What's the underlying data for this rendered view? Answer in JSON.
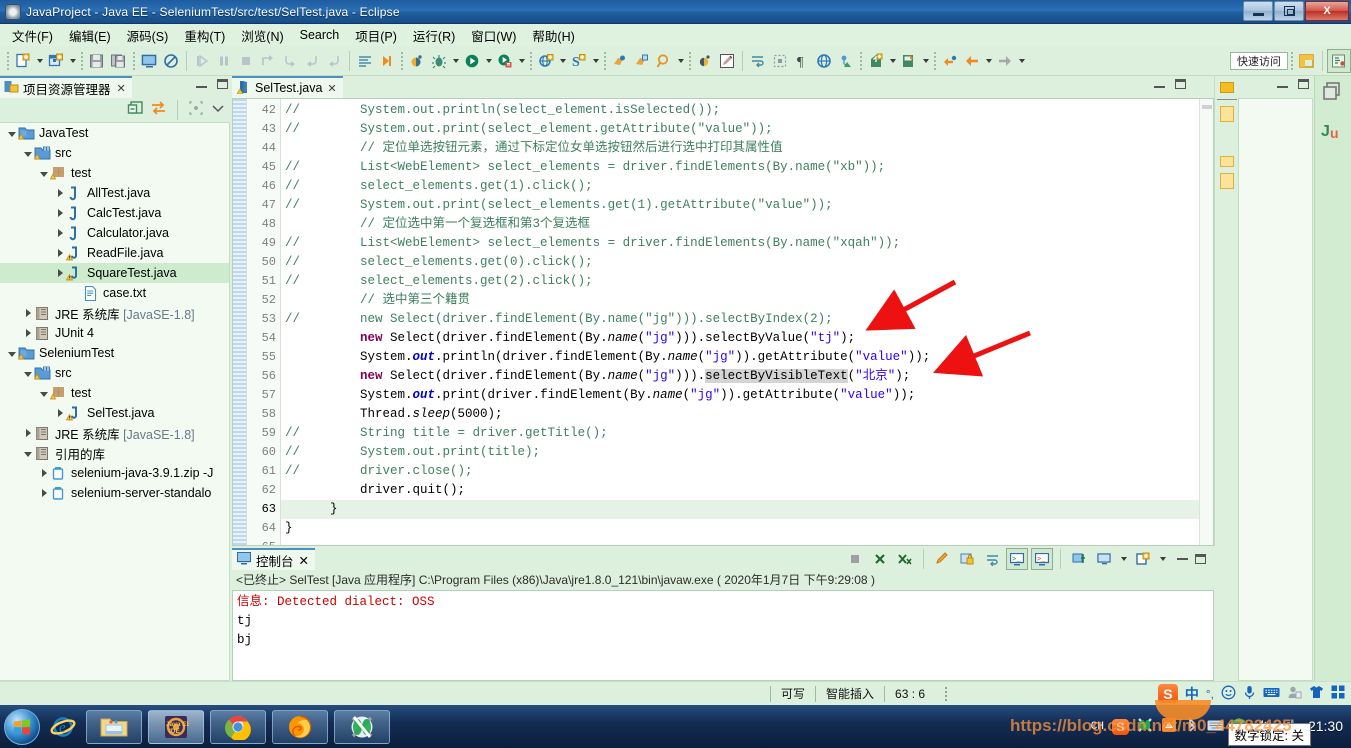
{
  "window": {
    "title": "JavaProject  -  Java EE  -  SeleniumTest/src/test/SelTest.java  -  Eclipse",
    "minimize_label": "最小化",
    "restore_label": "还原",
    "close_label": "X"
  },
  "menu": {
    "items": [
      {
        "label": "文件(F)"
      },
      {
        "label": "编辑(E)"
      },
      {
        "label": "源码(S)"
      },
      {
        "label": "重构(T)"
      },
      {
        "label": "浏览(N)"
      },
      {
        "label": "Search"
      },
      {
        "label": "项目(P)"
      },
      {
        "label": "运行(R)"
      },
      {
        "label": "窗口(W)"
      },
      {
        "label": "帮助(H)"
      }
    ]
  },
  "toolbar": {
    "quick_access": "快速访问",
    "icons": [
      "new-wizard-icon",
      "new-dropdown-icon",
      "new-java-project-icon",
      "new-java-dropdown-icon",
      "save-icon",
      "save-all-icon",
      "print-screen-icon",
      "no-entry-icon",
      "resume-icon",
      "suspend-icon",
      "terminate-icon",
      "step-over-icon",
      "step-into-icon",
      "step-return-icon",
      "step-out-icon",
      "format-icon",
      "run-last-tool-icon",
      "coverage-icon",
      "debug-icon",
      "debug-dropdown-icon",
      "run-icon",
      "run-dropdown-icon",
      "external-tools-icon",
      "external-tools-dropdown-icon",
      "web-browser-icon",
      "web-dropdown-icon",
      "search-string-icon",
      "search-dropdown-icon",
      "open-type-icon",
      "open-task-icon",
      "search-icon",
      "search-arrow-icon",
      "coverage-small-icon",
      "edit-icon",
      "toggle-mark-icon",
      "toggle-block-icon",
      "paragraph-icon",
      "globe-icon",
      "link-icon",
      "export-icon",
      "export-dropdown-icon",
      "import-icon",
      "import-dropdown-icon",
      "back-pin-icon",
      "back-icon",
      "back-dropdown-icon",
      "forward-icon",
      "forward-dropdown-icon"
    ],
    "perspective_new": "new-perspective-icon",
    "perspective_java_ee": "java-ee-perspective-icon"
  },
  "explorer": {
    "tab_title": "项目资源管理器",
    "tab_close": "✕",
    "toolbar_icons": [
      "collapse-all-icon",
      "link-with-editor-icon",
      "focus-icon",
      "view-menu-icon"
    ],
    "tree": [
      {
        "indent": 0,
        "twisty": "open",
        "icon": "java-project-icon",
        "label": "JavaTest",
        "selected": false
      },
      {
        "indent": 1,
        "twisty": "open",
        "icon": "source-folder-icon",
        "label": "src",
        "selected": false
      },
      {
        "indent": 2,
        "twisty": "open",
        "icon": "package-icon",
        "label": "test",
        "selected": false
      },
      {
        "indent": 3,
        "twisty": "closed",
        "icon": "java-file-icon",
        "label": "AllTest.java",
        "selected": false
      },
      {
        "indent": 3,
        "twisty": "closed",
        "icon": "java-file-icon",
        "label": "CalcTest.java",
        "selected": false
      },
      {
        "indent": 3,
        "twisty": "closed",
        "icon": "java-file-icon",
        "label": "Calculator.java",
        "selected": false
      },
      {
        "indent": 3,
        "twisty": "closed",
        "icon": "java-warn-file-icon",
        "label": "ReadFile.java",
        "selected": false
      },
      {
        "indent": 3,
        "twisty": "closed",
        "icon": "java-warn-file-icon",
        "label": "SquareTest.java",
        "selected": true
      },
      {
        "indent": 4,
        "twisty": "none",
        "icon": "text-file-icon",
        "label": "case.txt",
        "selected": false
      },
      {
        "indent": 1,
        "twisty": "closed",
        "icon": "library-icon",
        "label": "JRE 系统库 ",
        "dim": "[JavaSE-1.8]",
        "selected": false
      },
      {
        "indent": 1,
        "twisty": "closed",
        "icon": "library-icon",
        "label": "JUnit 4",
        "selected": false
      },
      {
        "indent": 0,
        "twisty": "open",
        "icon": "java-project-icon",
        "label": "SeleniumTest",
        "selected": false
      },
      {
        "indent": 1,
        "twisty": "open",
        "icon": "source-folder-icon",
        "label": "src",
        "selected": false
      },
      {
        "indent": 2,
        "twisty": "open",
        "icon": "package-icon",
        "label": "test",
        "selected": false
      },
      {
        "indent": 3,
        "twisty": "closed",
        "icon": "java-warn-file-icon",
        "label": "SelTest.java",
        "selected": false
      },
      {
        "indent": 1,
        "twisty": "closed",
        "icon": "library-icon",
        "label": "JRE 系统库 ",
        "dim": "[JavaSE-1.8]",
        "selected": false
      },
      {
        "indent": 1,
        "twisty": "open",
        "icon": "library-icon",
        "label": "引用的库",
        "selected": false
      },
      {
        "indent": 2,
        "twisty": "closed",
        "icon": "jar-icon",
        "label": "selenium-java-3.9.1.zip -J",
        "selected": false
      },
      {
        "indent": 2,
        "twisty": "closed",
        "icon": "jar-icon",
        "label": "selenium-server-standalo",
        "selected": false
      }
    ]
  },
  "editor": {
    "tab_label": "SelTest.java",
    "tab_close": "✕",
    "tab_icon": "java-warn-file-icon",
    "first_line_number": 42,
    "cursor_line": 63,
    "lines": [
      {
        "n": 42,
        "text": "//        System.out.println(select_element.isSelected());",
        "style": "comment"
      },
      {
        "n": 43,
        "text": "//        System.out.print(select_element.getAttribute(\"value\"));",
        "style": "comment"
      },
      {
        "n": 44,
        "text": "          // 定位单选按钮元素，通过下标定位女单选按钮然后进行选中打印其属性值",
        "style": "comment"
      },
      {
        "n": 45,
        "text": "//        List<WebElement> select_elements = driver.findElements(By.name(\"xb\"));",
        "style": "comment"
      },
      {
        "n": 46,
        "text": "//        select_elements.get(1).click();",
        "style": "comment"
      },
      {
        "n": 47,
        "text": "//        System.out.print(select_elements.get(1).getAttribute(\"value\"));",
        "style": "comment"
      },
      {
        "n": 48,
        "text": "          // 定位选中第一个复选框和第3个复选框",
        "style": "comment"
      },
      {
        "n": 49,
        "text": "//        List<WebElement> select_elements = driver.findElements(By.name(\"xqah\"));",
        "style": "comment"
      },
      {
        "n": 50,
        "text": "//        select_elements.get(0).click();",
        "style": "comment"
      },
      {
        "n": 51,
        "text": "//        select_elements.get(2).click();",
        "style": "comment"
      },
      {
        "n": 52,
        "text": "          // 选中第三个籍贯",
        "style": "comment"
      },
      {
        "n": 53,
        "text": "//        new Select(driver.findElement(By.name(\"jg\"))).selectByIndex(2);",
        "style": "comment"
      },
      {
        "n": 54,
        "text": "          new Select(driver.findElement(By.name(\"jg\"))).selectByValue(\"tj\");",
        "style": "code"
      },
      {
        "n": 55,
        "text": "          System.out.println(driver.findElement(By.name(\"jg\")).getAttribute(\"value\"));",
        "style": "code"
      },
      {
        "n": 56,
        "text": "          new Select(driver.findElement(By.name(\"jg\"))).selectByVisibleText(\"北京\");",
        "style": "code"
      },
      {
        "n": 57,
        "text": "          System.out.print(driver.findElement(By.name(\"jg\")).getAttribute(\"value\"));",
        "style": "code"
      },
      {
        "n": 58,
        "text": "          Thread.sleep(5000);",
        "style": "code"
      },
      {
        "n": 59,
        "text": "//        String title = driver.getTitle();",
        "style": "comment"
      },
      {
        "n": 60,
        "text": "//        System.out.print(title);",
        "style": "comment"
      },
      {
        "n": 61,
        "text": "//        driver.close();",
        "style": "comment"
      },
      {
        "n": 62,
        "text": "          driver.quit();",
        "style": "code"
      },
      {
        "n": 63,
        "text": "      }",
        "style": "code"
      },
      {
        "n": 64,
        "text": "}",
        "style": "code"
      },
      {
        "n": 65,
        "text": "",
        "style": "code"
      }
    ]
  },
  "console": {
    "tab_title": "控制台",
    "tab_close": "✕",
    "tab_icon": "console-icon",
    "header": "<已终止> SelTest [Java 应用程序] C:\\Program Files (x86)\\Java\\jre1.8.0_121\\bin\\javaw.exe ( 2020年1月7日 下午9:29:08 )",
    "output": [
      {
        "text": "信息: Detected dialect: OSS",
        "error": true
      },
      {
        "text": "tj",
        "error": false
      },
      {
        "text": "bj",
        "error": false
      }
    ],
    "toolbar_icons": [
      "terminate-icon",
      "remove-launch-icon",
      "remove-all-terminated-icon",
      "clear-console-icon",
      "scroll-lock-icon",
      "word-wrap-icon",
      "show-console-stdout-icon",
      "show-console-stderr-icon",
      "pin-console-icon",
      "display-selected-console-icon",
      "display-dropdown-icon",
      "open-console-icon",
      "open-console-dropdown-icon",
      "minimize-icon",
      "maximize-icon"
    ]
  },
  "statusbar": {
    "writable": "可写",
    "insert_mode": "智能插入",
    "position": "63 : 6",
    "ime_mode": "中",
    "ime_icons": [
      "sogou-logo-icon",
      "chinese-mode-icon",
      "punctuation-icon",
      "emoji-icon",
      "voice-input-icon",
      "soft-keyboard-icon",
      "user-icon",
      "skin-icon",
      "toolbox-icon"
    ]
  },
  "taskbar": {
    "start_label": "开始",
    "items": [
      {
        "name": "internet-explorer-icon",
        "label": "Internet Explorer",
        "active": false,
        "quick": true
      },
      {
        "name": "file-explorer-icon",
        "label": "资源管理器",
        "active": false,
        "quick": false
      },
      {
        "name": "eclipse-javaee-icon",
        "label": "Java EE IDE",
        "active": true,
        "quick": false
      },
      {
        "name": "chrome-icon",
        "label": "Google Chrome",
        "active": false,
        "quick": false
      },
      {
        "name": "firefox-icon",
        "label": "Firefox",
        "active": false,
        "quick": false
      },
      {
        "name": "xmind-icon",
        "label": "XMind",
        "active": false,
        "quick": false
      }
    ],
    "tray": {
      "language": "CH",
      "icons": [
        "sogou-tray-icon",
        "xmind-tray-icon",
        "qq-tray-icon",
        "bluetooth-tray-icon",
        "keyboard-tray-icon",
        "shield-tray-icon",
        "volume-tray-icon",
        "network-tray-icon"
      ],
      "clock_time": "21:30",
      "numlock_tooltip": "数字锁定: 关"
    },
    "watermark": "https://blog.csdn.net/m0_44782425"
  },
  "annotations": {
    "arrow1_target": "selectByValue(\"tj\")",
    "arrow2_target": "selectByVisibleText(\"北京\")",
    "color": "#ee1111"
  }
}
